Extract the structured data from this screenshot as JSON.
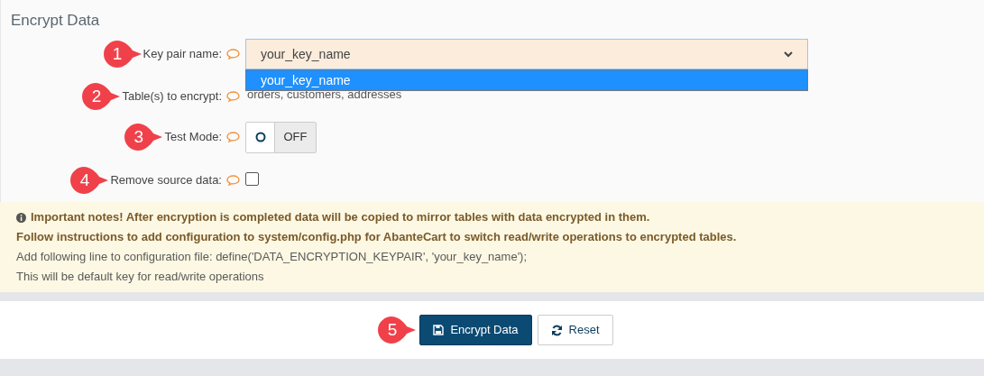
{
  "title": "Encrypt Data",
  "fields": [
    {
      "marker": "1",
      "label": "Key pair name:",
      "kind": "select",
      "value": "your_key_name",
      "options": [
        {
          "label": "your_key_name",
          "selected": true
        }
      ]
    },
    {
      "marker": "2",
      "label": "Table(s) to encrypt:",
      "kind": "text",
      "value": "orders, customers, addresses"
    },
    {
      "marker": "3",
      "label": "Test Mode:",
      "kind": "toggle",
      "on": false,
      "off_label": "OFF"
    },
    {
      "marker": "4",
      "label": "Remove source data:",
      "kind": "checkbox",
      "checked": false
    }
  ],
  "notes": [
    {
      "kind": "important",
      "text": "Important notes! After encryption is completed data will be copied to mirror tables with data encrypted in them."
    },
    {
      "kind": "important",
      "text": "Follow instructions to add configuration to system/config.php for AbanteCart to switch read/write operations to encrypted tables."
    },
    {
      "kind": "plain",
      "text": "Add following line to configuration file: define('DATA_ENCRYPTION_KEYPAIR', 'your_key_name');"
    },
    {
      "kind": "plain",
      "text": "This will be default key for read/write operations"
    }
  ],
  "footer": {
    "marker": "5",
    "buttons": [
      {
        "kind": "primary",
        "label": "Encrypt Data"
      },
      {
        "kind": "reset",
        "label": "Reset"
      }
    ]
  }
}
